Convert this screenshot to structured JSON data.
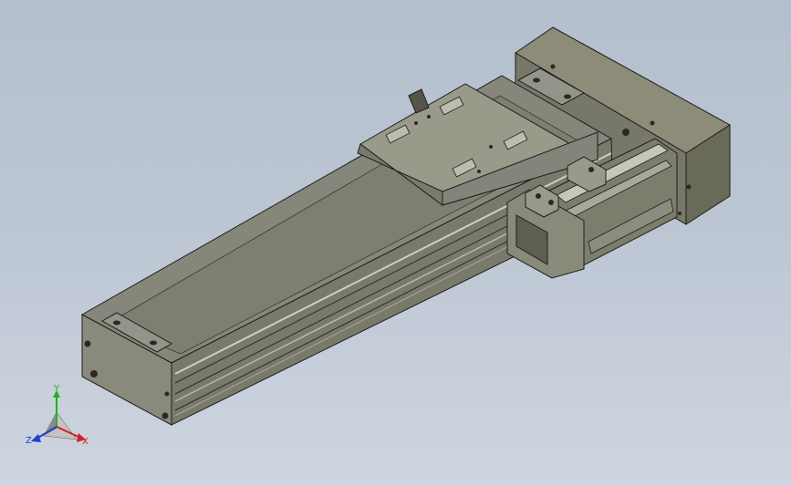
{
  "viewport": {
    "background_top": "#b4bfcd",
    "background_bottom": "#cdd5df",
    "model_color": "#7d7d6b"
  },
  "triad": {
    "x_label": "X",
    "y_label": "Y",
    "z_label": "Z",
    "x_color": "#d42020",
    "y_color": "#22b022",
    "z_color": "#1f3fd0"
  }
}
